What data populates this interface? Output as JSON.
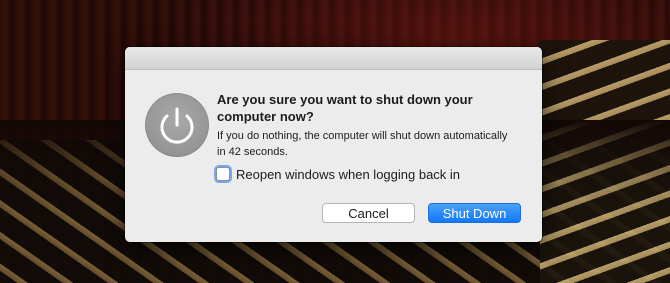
{
  "dialog": {
    "icon": "power-icon",
    "title": "Are you sure you want to shut down your computer now?",
    "message": "If you do nothing, the computer will shut down automatically in 42 seconds.",
    "checkbox": {
      "label": "Reopen windows when logging back in",
      "checked": false
    },
    "buttons": {
      "cancel": "Cancel",
      "shutdown": "Shut Down"
    },
    "colors": {
      "accent": "#1278f6",
      "background": "#ececec"
    }
  }
}
